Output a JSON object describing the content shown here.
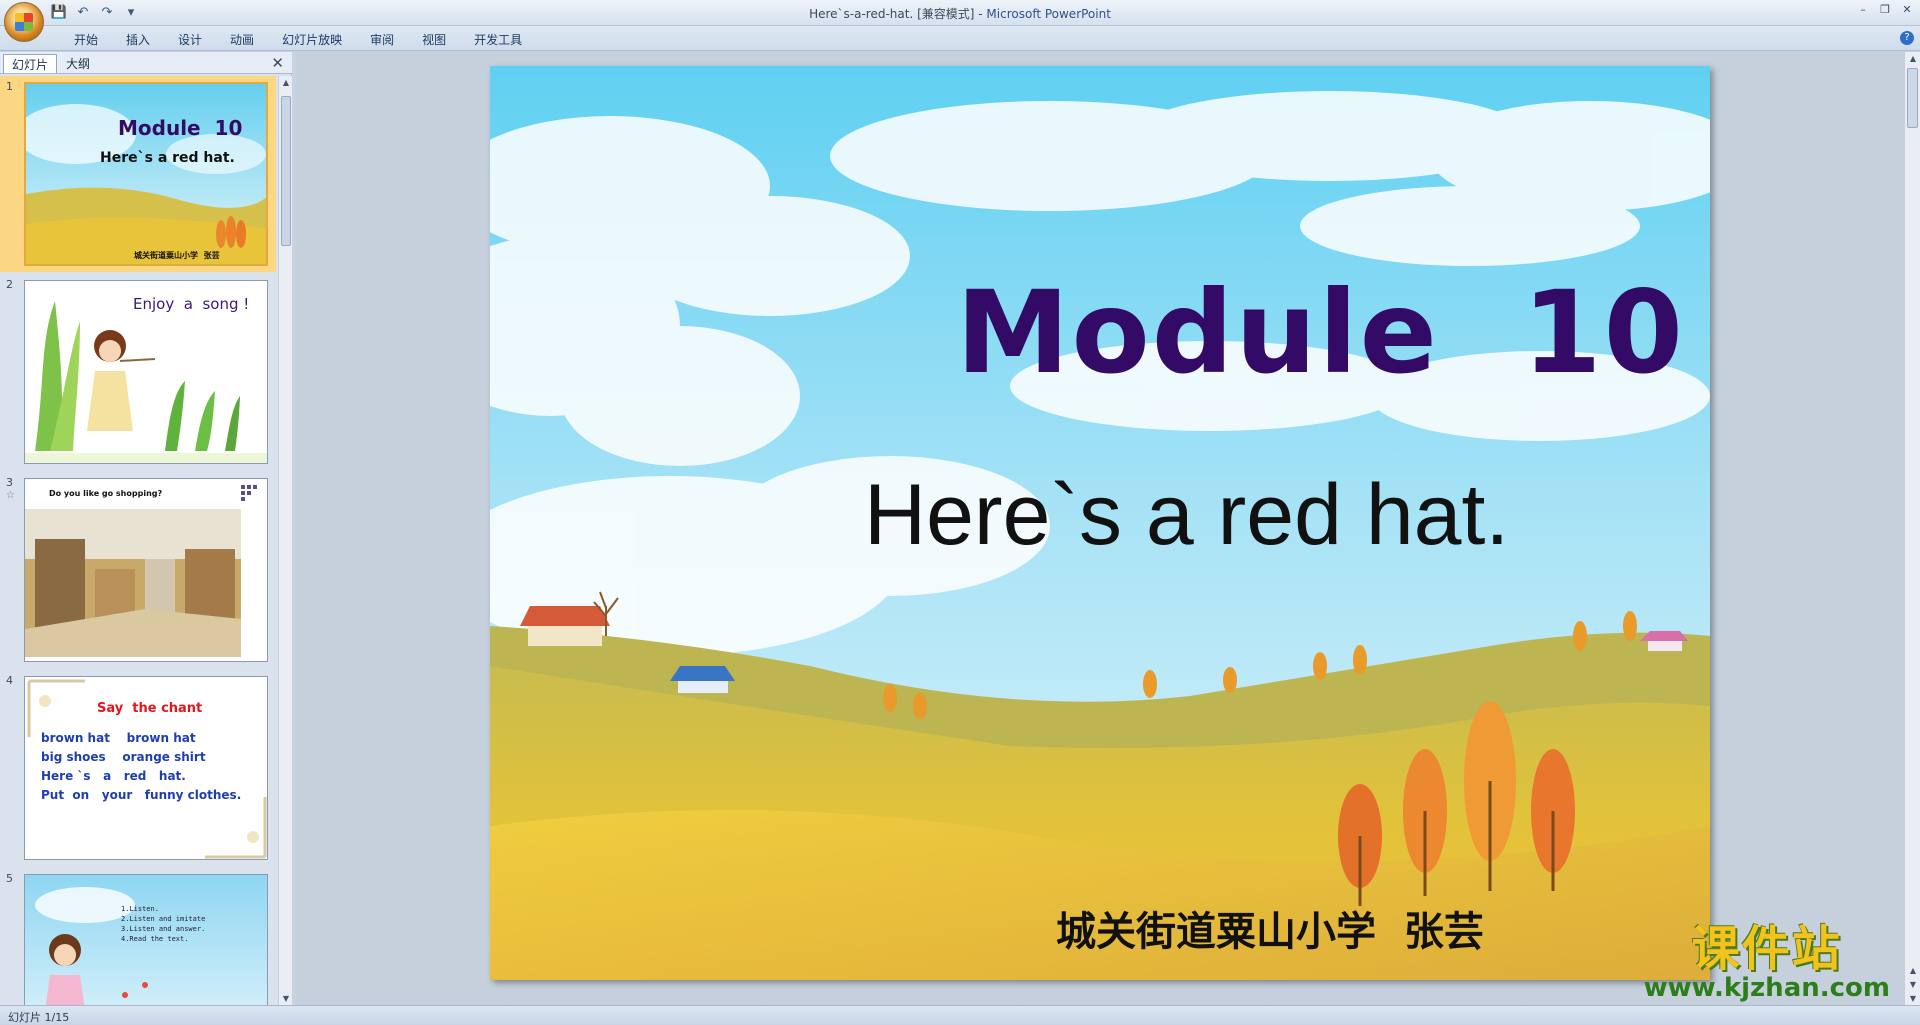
{
  "window": {
    "title_doc": "Here`s-a-red-hat. [兼容模式]",
    "title_sep": " - ",
    "title_app": "Microsoft PowerPoint"
  },
  "ribbon": {
    "tabs": [
      "开始",
      "插入",
      "设计",
      "动画",
      "幻灯片放映",
      "审阅",
      "视图",
      "开发工具"
    ]
  },
  "left_pane": {
    "tab_slides": "幻灯片",
    "tab_outline": "大纲",
    "thumbnails": [
      {
        "num": "1",
        "title": "Module  10",
        "subtitle": "Here`s a red hat.",
        "author": "城关街道粟山小学  张芸"
      },
      {
        "num": "2",
        "text": "Enjoy  a  song !"
      },
      {
        "num": "3",
        "text": "Do you like go shopping?"
      },
      {
        "num": "4",
        "title": "Say  the chant",
        "lines": [
          "brown hat    brown hat",
          "big shoes    orange shirt",
          "Here `s   a   red   hat.",
          "Put  on   your   funny clothes."
        ]
      },
      {
        "num": "5",
        "lines": [
          "1.Listen.",
          "2.Listen and imitate",
          "3.Listen and answer.",
          "4.Read the text."
        ]
      }
    ]
  },
  "slide": {
    "title": "Module  10",
    "subtitle": "Here`s a red hat.",
    "author": "城关街道粟山小学  张芸"
  },
  "watermark": {
    "cn": "课件站",
    "url": "www.kjzhan.com"
  },
  "status": {
    "slide_counter": "幻灯片 1/15"
  },
  "colors": {
    "title_purple": "#330a66",
    "sky": "#7fd4f2",
    "grass": "#e2c23a"
  }
}
